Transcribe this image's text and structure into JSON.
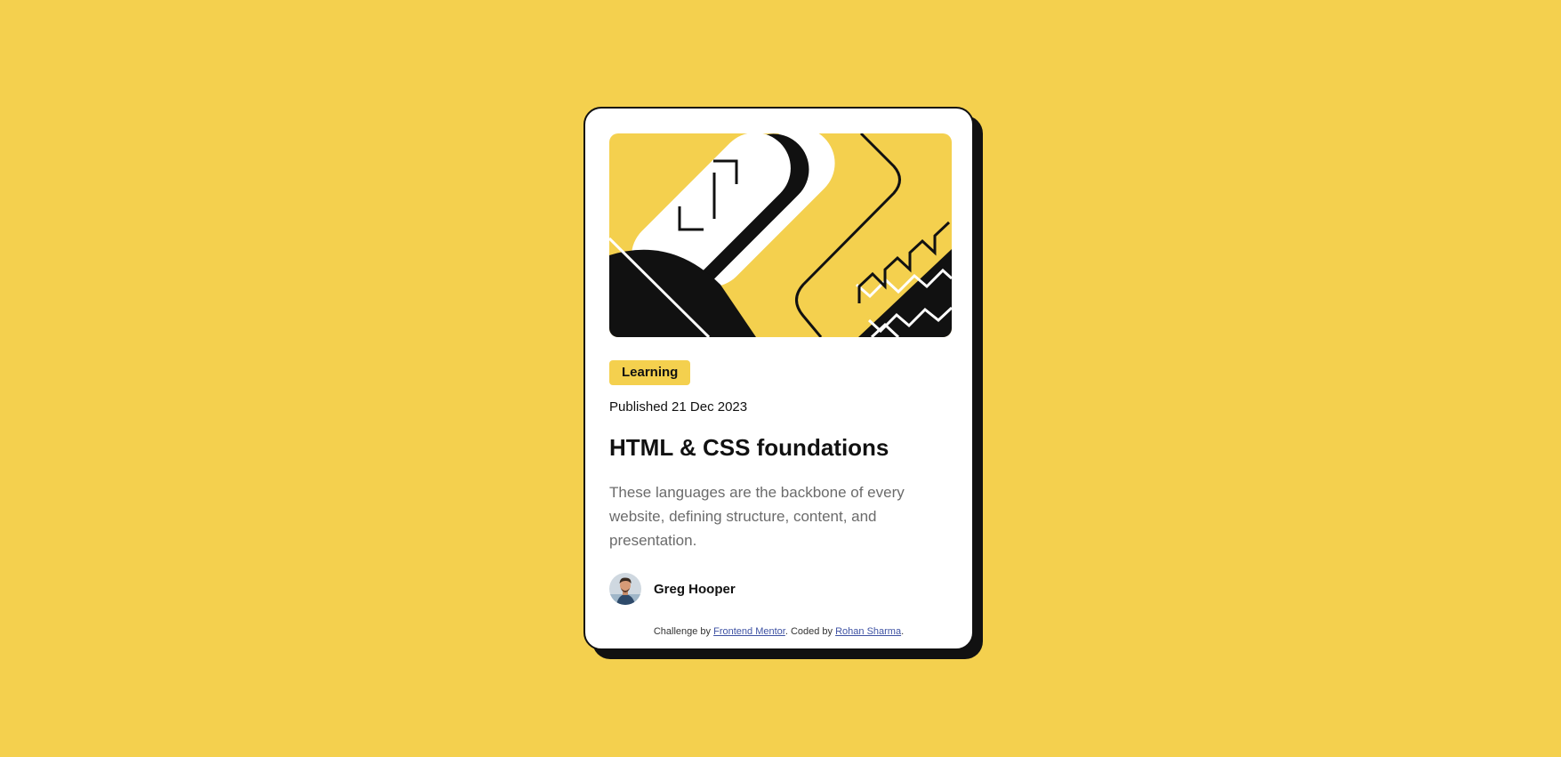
{
  "colors": {
    "background": "#f4d04e",
    "card": "#ffffff",
    "ink": "#111111",
    "muted": "#6b6b6b"
  },
  "card": {
    "image": {
      "icon": "illustration-article-icon"
    },
    "tag": "Learning",
    "published": "Published 21 Dec 2023",
    "title": "HTML & CSS foundations",
    "description": "These languages are the backbone of every website, defining structure, content, and presentation.",
    "author": {
      "name": "Greg Hooper",
      "avatar_icon": "avatar-icon"
    }
  },
  "attribution": {
    "prefix": "Challenge by ",
    "link1": "Frontend Mentor",
    "middle": ". Coded by ",
    "link2": "Rohan Sharma",
    "suffix": "."
  }
}
